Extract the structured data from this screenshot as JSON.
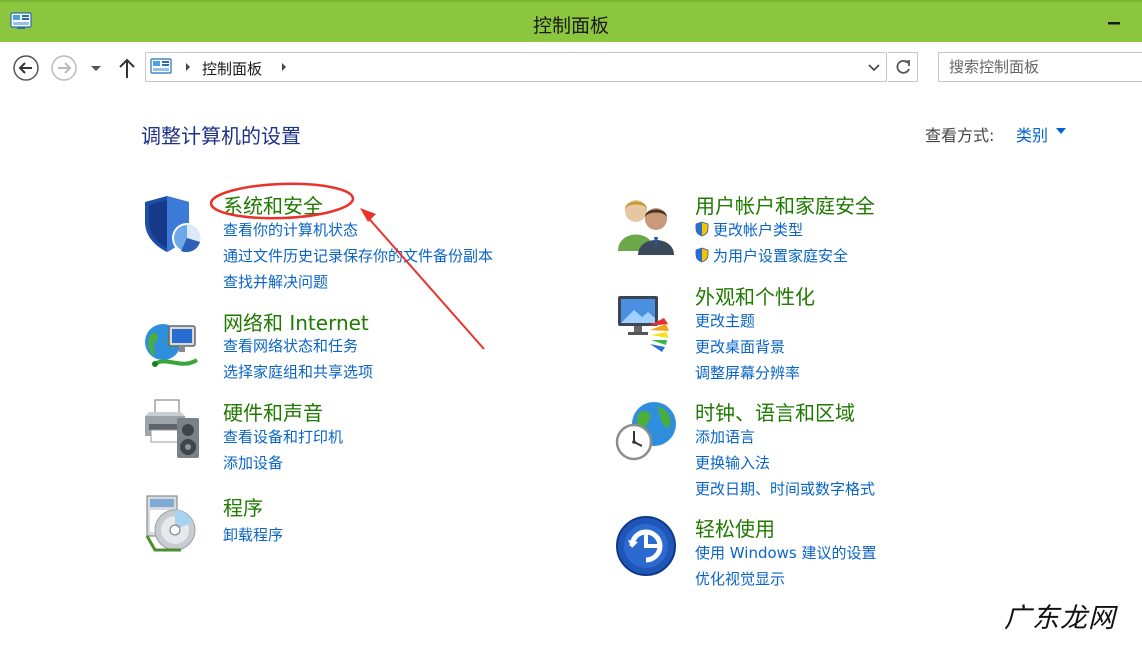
{
  "window": {
    "title": "控制面板"
  },
  "address": {
    "crumb": "控制面板"
  },
  "search": {
    "placeholder": "搜索控制面板"
  },
  "page": {
    "title": "调整计算机的设置",
    "view_label": "查看方式:",
    "view_value": "类别"
  },
  "categories_left": [
    {
      "title": "系统和安全",
      "icon": "shield-icon",
      "links": [
        "查看你的计算机状态",
        "通过文件历史记录保存你的文件备份副本",
        "查找并解决问题"
      ]
    },
    {
      "title": "网络和 Internet",
      "icon": "network-globe-icon",
      "links": [
        "查看网络状态和任务",
        "选择家庭组和共享选项"
      ]
    },
    {
      "title": "硬件和声音",
      "icon": "printer-speaker-icon",
      "links": [
        "查看设备和打印机",
        "添加设备"
      ]
    },
    {
      "title": "程序",
      "icon": "programs-disc-icon",
      "links": [
        "卸载程序"
      ]
    }
  ],
  "categories_right": [
    {
      "title": "用户帐户和家庭安全",
      "icon": "users-icon",
      "links": [
        "更改帐户类型",
        "为用户设置家庭安全"
      ]
    },
    {
      "title": "外观和个性化",
      "icon": "monitor-palette-icon",
      "links": [
        "更改主题",
        "更改桌面背景",
        "调整屏幕分辨率"
      ]
    },
    {
      "title": "时钟、语言和区域",
      "icon": "clock-globe-icon",
      "links": [
        "添加语言",
        "更换输入法",
        "更改日期、时间或数字格式"
      ]
    },
    {
      "title": "轻松使用",
      "icon": "ease-of-access-icon",
      "links": [
        "使用 Windows 建议的设置",
        "优化视觉显示"
      ]
    }
  ],
  "watermark": "广东龙网",
  "colors": {
    "titlebar": "#8cc63f",
    "category_title": "#1f7a00",
    "link": "#0a64c8",
    "page_title": "#1e3287",
    "annotation": "#e8322b"
  }
}
